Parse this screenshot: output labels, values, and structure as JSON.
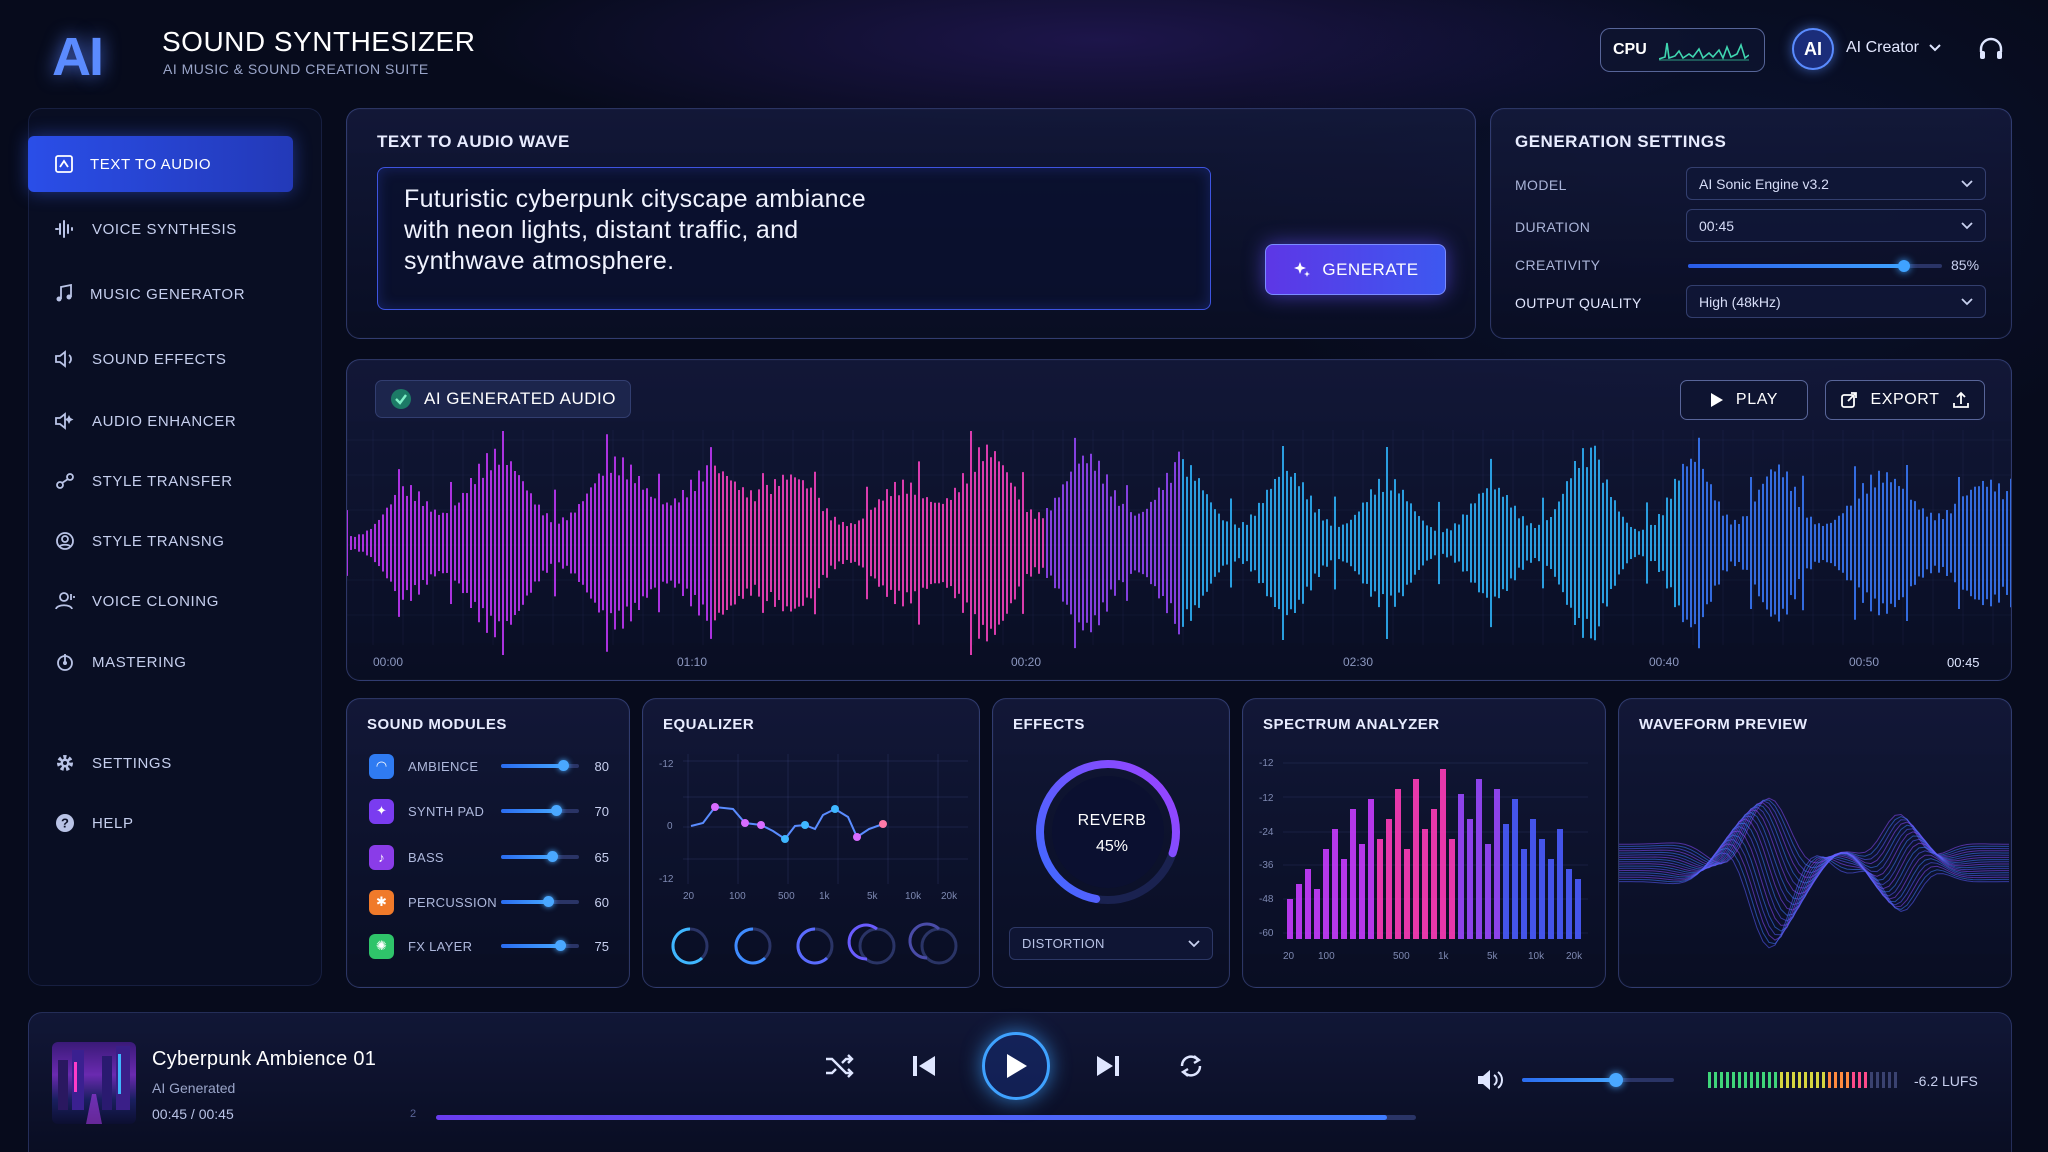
{
  "header": {
    "logo": "AI",
    "title": "SOUND SYNTHESIZER",
    "subtitle": "AI MUSIC & SOUND CREATION SUITE",
    "cpu_label": "CPU",
    "avatar_text": "AI",
    "user_name": "AI Creator"
  },
  "sidebar": {
    "items": [
      {
        "label": "TEXT TO AUDIO",
        "active": true
      },
      {
        "label": "VOICE SYNTHESIS"
      },
      {
        "label": "MUSIC GENERATOR"
      },
      {
        "label": "SOUND EFFECTS"
      },
      {
        "label": "AUDIO ENHANCER"
      },
      {
        "label": "STYLE TRANSFER"
      },
      {
        "label": "STYLE TRANSNG"
      },
      {
        "label": "VOICE CLONING"
      },
      {
        "label": "MASTERING"
      }
    ],
    "footer": [
      {
        "label": "SETTINGS"
      },
      {
        "label": "HELP"
      }
    ]
  },
  "text_to_audio": {
    "title": "TEXT TO AUDIO WAVE",
    "prompt_line1": "Futuristic cyberpunk cityscape ambiance",
    "prompt_line2": "with neon lights, distant traffic, and",
    "prompt_line3": "synthwave atmosphere.",
    "generate_label": "GENERATE"
  },
  "generation_settings": {
    "title": "GENERATION SETTINGS",
    "model_label": "MODEL",
    "model_value": "AI Sonic Engine v3.2",
    "duration_label": "DURATION",
    "duration_value": "00:45",
    "creativity_label": "CREATIVITY",
    "creativity_value": "85%",
    "creativity_level": 0.85,
    "quality_label": "OUTPUT QUALITY",
    "quality_value": "High (48kHz)"
  },
  "waveform": {
    "badge": "AI GENERATED AUDIO",
    "play_label": "PLAY",
    "export_label": "EXPORT",
    "timeline": [
      "00:00",
      "01:10",
      "00:20",
      "02:30",
      "00:40",
      "00:50",
      "00:45"
    ]
  },
  "sound_modules": {
    "title": "SOUND MODULES",
    "items": [
      {
        "name": "AMBIENCE",
        "value": 80,
        "color": "#2f7bf2"
      },
      {
        "name": "SYNTH PAD",
        "value": 70,
        "color": "#7a3cf0"
      },
      {
        "name": "BASS",
        "value": 65,
        "color": "#8a3ce8"
      },
      {
        "name": "PERCUSSION",
        "value": 60,
        "color": "#f07a2a"
      },
      {
        "name": "FX LAYER",
        "value": 75,
        "color": "#2fc46a"
      }
    ]
  },
  "equalizer": {
    "title": "EQUALIZER",
    "y_labels": [
      "-12",
      "0",
      "-12"
    ],
    "x_labels": [
      "20",
      "100",
      "500",
      "1k",
      "5k",
      "10k",
      "20k"
    ]
  },
  "effects": {
    "title": "EFFECTS",
    "knob_label": "REVERB",
    "knob_value": "45%",
    "dropdown": "DISTORTION"
  },
  "spectrum": {
    "title": "SPECTRUM ANALYZER",
    "y_labels": [
      "-12",
      "-12",
      "-24",
      "-36",
      "-48",
      "-60"
    ],
    "x_labels": [
      "20",
      "100",
      "500",
      "1k",
      "5k",
      "10k",
      "20k"
    ]
  },
  "waveform_preview": {
    "title": "WAVEFORM PREVIEW"
  },
  "player": {
    "track_title": "Cyberpunk Ambience 01",
    "track_sub": "AI Generated",
    "time": "00:45 / 00:45",
    "progress_marker": "2",
    "progress": 0.97,
    "volume": 0.62,
    "loudness": "-6.2 LUFS"
  },
  "colors": {
    "accent": "#3d58f0",
    "magenta": "#e23cff",
    "cyan": "#2fb7ff"
  }
}
